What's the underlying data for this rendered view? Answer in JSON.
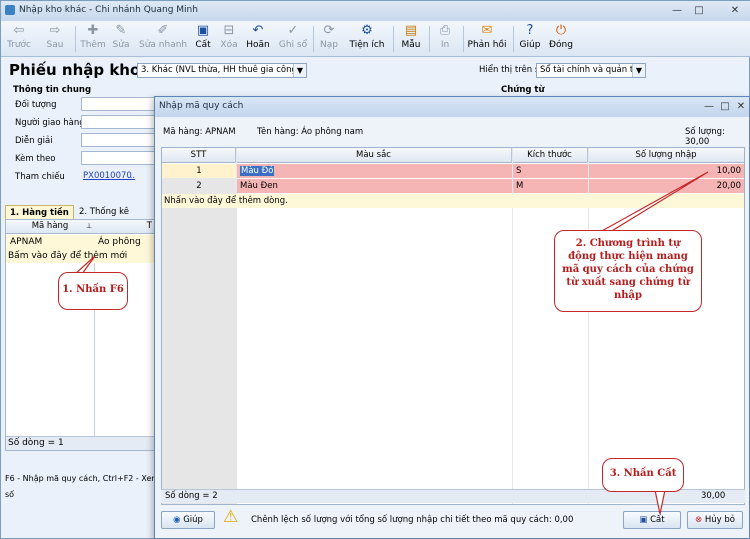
{
  "window": {
    "title": "Nhập kho khác - Chi nhánh Quang Minh"
  },
  "toolbar": {
    "items": [
      {
        "label": "Trước",
        "icon": "arrow-left-icon"
      },
      {
        "label": "Sau",
        "icon": "arrow-right-icon"
      },
      {
        "label": "Thêm",
        "icon": "add-icon"
      },
      {
        "label": "Sửa",
        "icon": "edit-icon"
      },
      {
        "label": "Sửa nhanh",
        "icon": "quick-edit-icon"
      },
      {
        "label": "Cất",
        "icon": "save-icon"
      },
      {
        "label": "Xóa",
        "icon": "delete-icon"
      },
      {
        "label": "Hoãn",
        "icon": "undo-icon"
      },
      {
        "label": "Ghi sổ",
        "icon": "post-icon"
      },
      {
        "label": "Nạp",
        "icon": "reload-icon"
      },
      {
        "label": "Tiện ích",
        "icon": "utility-icon"
      },
      {
        "label": "Mẫu",
        "icon": "template-icon"
      },
      {
        "label": "In",
        "icon": "print-icon"
      },
      {
        "label": "Phản hồi",
        "icon": "mail-icon"
      },
      {
        "label": "Giúp",
        "icon": "help-icon"
      },
      {
        "label": "Đóng",
        "icon": "close-icon"
      }
    ]
  },
  "voucher": {
    "title": "Phiếu nhập kho",
    "type_value": "3. Khác (NVL thừa, HH thuê gia công,...",
    "display_label": "Hiển thị trên sổ",
    "display_value": "Sổ tài chính và quản trị",
    "general_group": "Thông tin chung",
    "doc_group": "Chứng từ",
    "fields": [
      "Đối tượng",
      "Người giao hàng",
      "Diễn giải",
      "Kèm theo",
      "Tham chiếu"
    ],
    "reference_value": "PX0010070",
    "reference_more": "...",
    "tabs": [
      "1. Hàng tiền",
      "2. Thống kê"
    ],
    "grid": {
      "col_code": "Mã hàng",
      "col_next": "T",
      "row_code": "APNAM",
      "row_name": "Áo phông nam",
      "hint": "Bấm vào đây để thêm mới",
      "row_count": "Số dòng = 1"
    },
    "status_hint": "F6 - Nhập mã quy cách, Ctrl+F2 - Xem số"
  },
  "dialog": {
    "title": "Nhập mã quy cách",
    "item_code_label": "Mã hàng: APNAM",
    "item_name_label": "Tên hàng: Áo phông nam",
    "qty_label": "Số lượng: 30,00",
    "columns": [
      "STT",
      "Màu sắc",
      "Kích thước",
      "Số lượng nhập"
    ],
    "rows": [
      {
        "stt": "1",
        "color": "Màu Đỏ",
        "size": "S",
        "qty": "10,00"
      },
      {
        "stt": "2",
        "color": "Màu Đen",
        "size": "M",
        "qty": "20,00"
      }
    ],
    "add_hint": "Nhấn vào đây để thêm dòng.",
    "row_count": "Số dòng = 2",
    "total": "30,00",
    "warning": "Chênh lệch số lượng với tổng số lượng nhập chi tiết theo mã quy cách: 0,00",
    "buttons": {
      "help": "Giúp",
      "save": "Cất",
      "cancel": "Hủy bỏ"
    }
  },
  "callouts": {
    "c1": "1. Nhấn F6",
    "c2": "2. Chương trình tự động thực hiện mang mã quy cách của chứng từ xuất sang chứng từ nhập",
    "c3": "3. Nhấn Cất"
  }
}
